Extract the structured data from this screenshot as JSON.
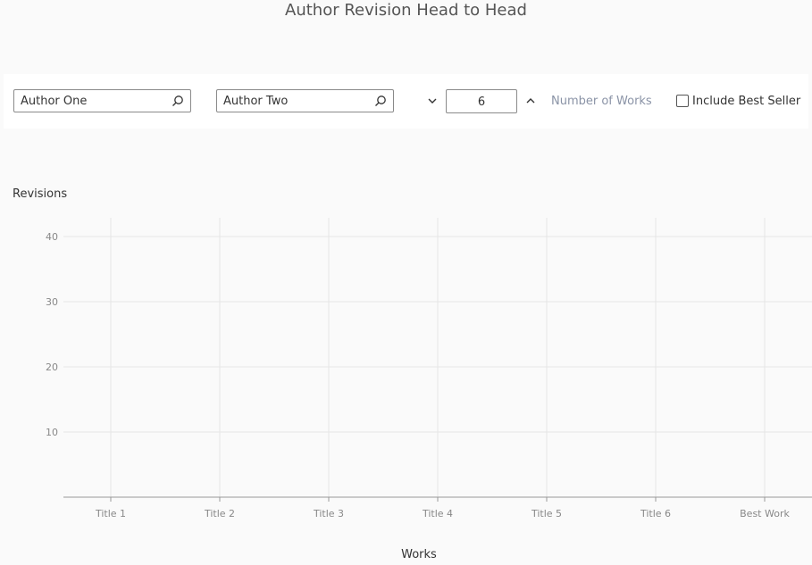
{
  "page": {
    "title": "Author Revision Head to Head"
  },
  "toolbar": {
    "author_one": {
      "value": "Author One",
      "icon": "search-icon"
    },
    "author_two": {
      "value": "Author Two",
      "icon": "search-icon"
    },
    "decrement_icon": "chevron-down-icon",
    "increment_icon": "chevron-up-icon",
    "number_of_works": {
      "value": "6",
      "label": "Number of Works"
    },
    "best_seller": {
      "label": "Include Best Seller",
      "checked": false
    }
  },
  "chart_data": {
    "type": "bar",
    "title": "",
    "ylabel": "Revisions",
    "xlabel": "Works",
    "categories": [
      "Title 1",
      "Title 2",
      "Title 3",
      "Title 4",
      "Title 5",
      "Title 6",
      "Best Work"
    ],
    "yticks": [
      10,
      20,
      30,
      40
    ],
    "ylim": [
      0,
      40
    ],
    "series": [],
    "grid": true,
    "colors": {
      "grid": "#e6e6e6",
      "axis": "#999999",
      "tick_text": "#888888"
    }
  }
}
